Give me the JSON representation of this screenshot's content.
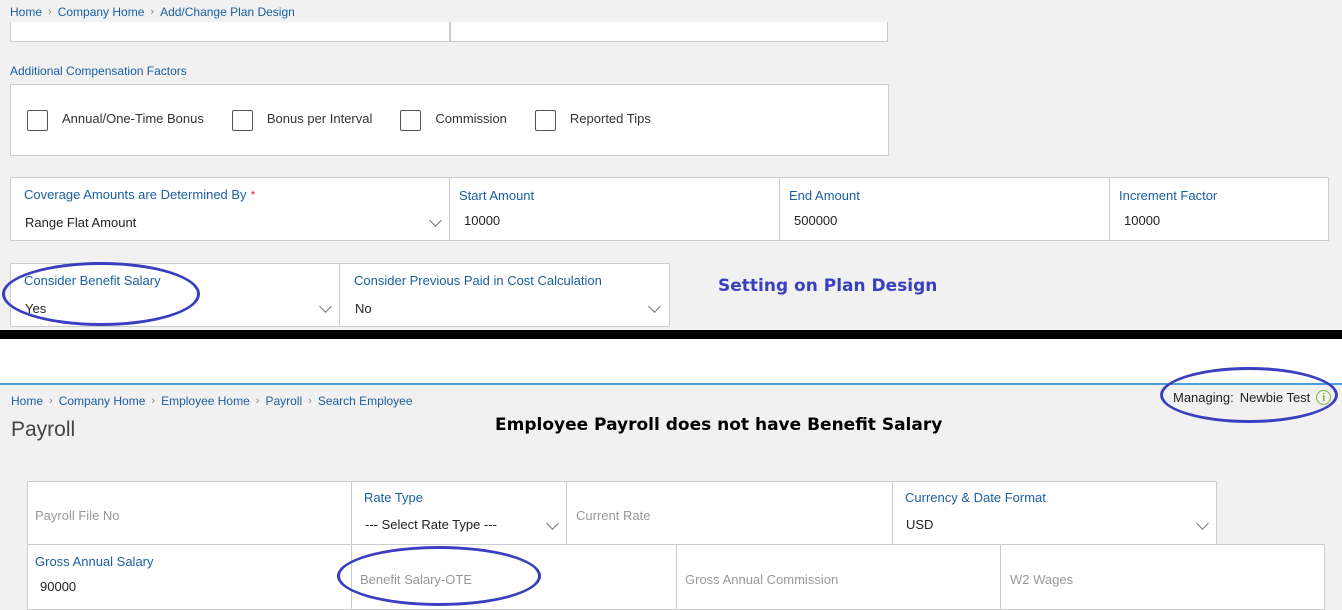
{
  "top": {
    "breadcrumbs": [
      "Home",
      "Company Home",
      "Add/Change Plan Design"
    ],
    "additional_comp_label": "Additional Compensation Factors",
    "checkboxes": [
      "Annual/One-Time Bonus",
      "Bonus per Interval",
      "Commission",
      "Reported Tips"
    ],
    "coverage": {
      "label": "Coverage Amounts are Determined By",
      "required_mark": "*",
      "value": "Range Flat Amount"
    },
    "start_amount": {
      "label": "Start Amount",
      "value": "10000"
    },
    "end_amount": {
      "label": "End Amount",
      "value": "500000"
    },
    "increment_factor": {
      "label": "Increment Factor",
      "value": "10000"
    },
    "consider_benefit_salary": {
      "label": "Consider Benefit Salary",
      "value": "Yes"
    },
    "consider_previous_paid": {
      "label": "Consider Previous Paid in Cost Calculation",
      "value": "No"
    },
    "annotation": "Setting on Plan Design"
  },
  "bottom": {
    "breadcrumbs": [
      "Home",
      "Company Home",
      "Employee Home",
      "Payroll",
      "Search Employee"
    ],
    "managing_label": "Managing:",
    "managing_user": "Newbie Test",
    "page_title": "Payroll",
    "annotation": "Employee Payroll does not have Benefit Salary",
    "payroll_file_no": {
      "placeholder": "Payroll File No"
    },
    "rate_type": {
      "label": "Rate Type",
      "value": "--- Select Rate Type ---"
    },
    "current_rate": {
      "placeholder": "Current Rate"
    },
    "currency_date_format": {
      "label": "Currency & Date Format",
      "value": "USD"
    },
    "gross_annual_salary": {
      "label": "Gross Annual Salary",
      "value": "90000"
    },
    "benefit_salary_ote": {
      "placeholder": "Benefit Salary-OTE"
    },
    "gross_annual_commission": {
      "placeholder": "Gross Annual Commission"
    },
    "w2_wages": {
      "placeholder": "W2 Wages"
    }
  },
  "colors": {
    "link_blue": "#1a5fa3",
    "annotation_blue": "#3a3fc0",
    "divider_black": "#000000",
    "accent_line": "#4a9fdc"
  }
}
